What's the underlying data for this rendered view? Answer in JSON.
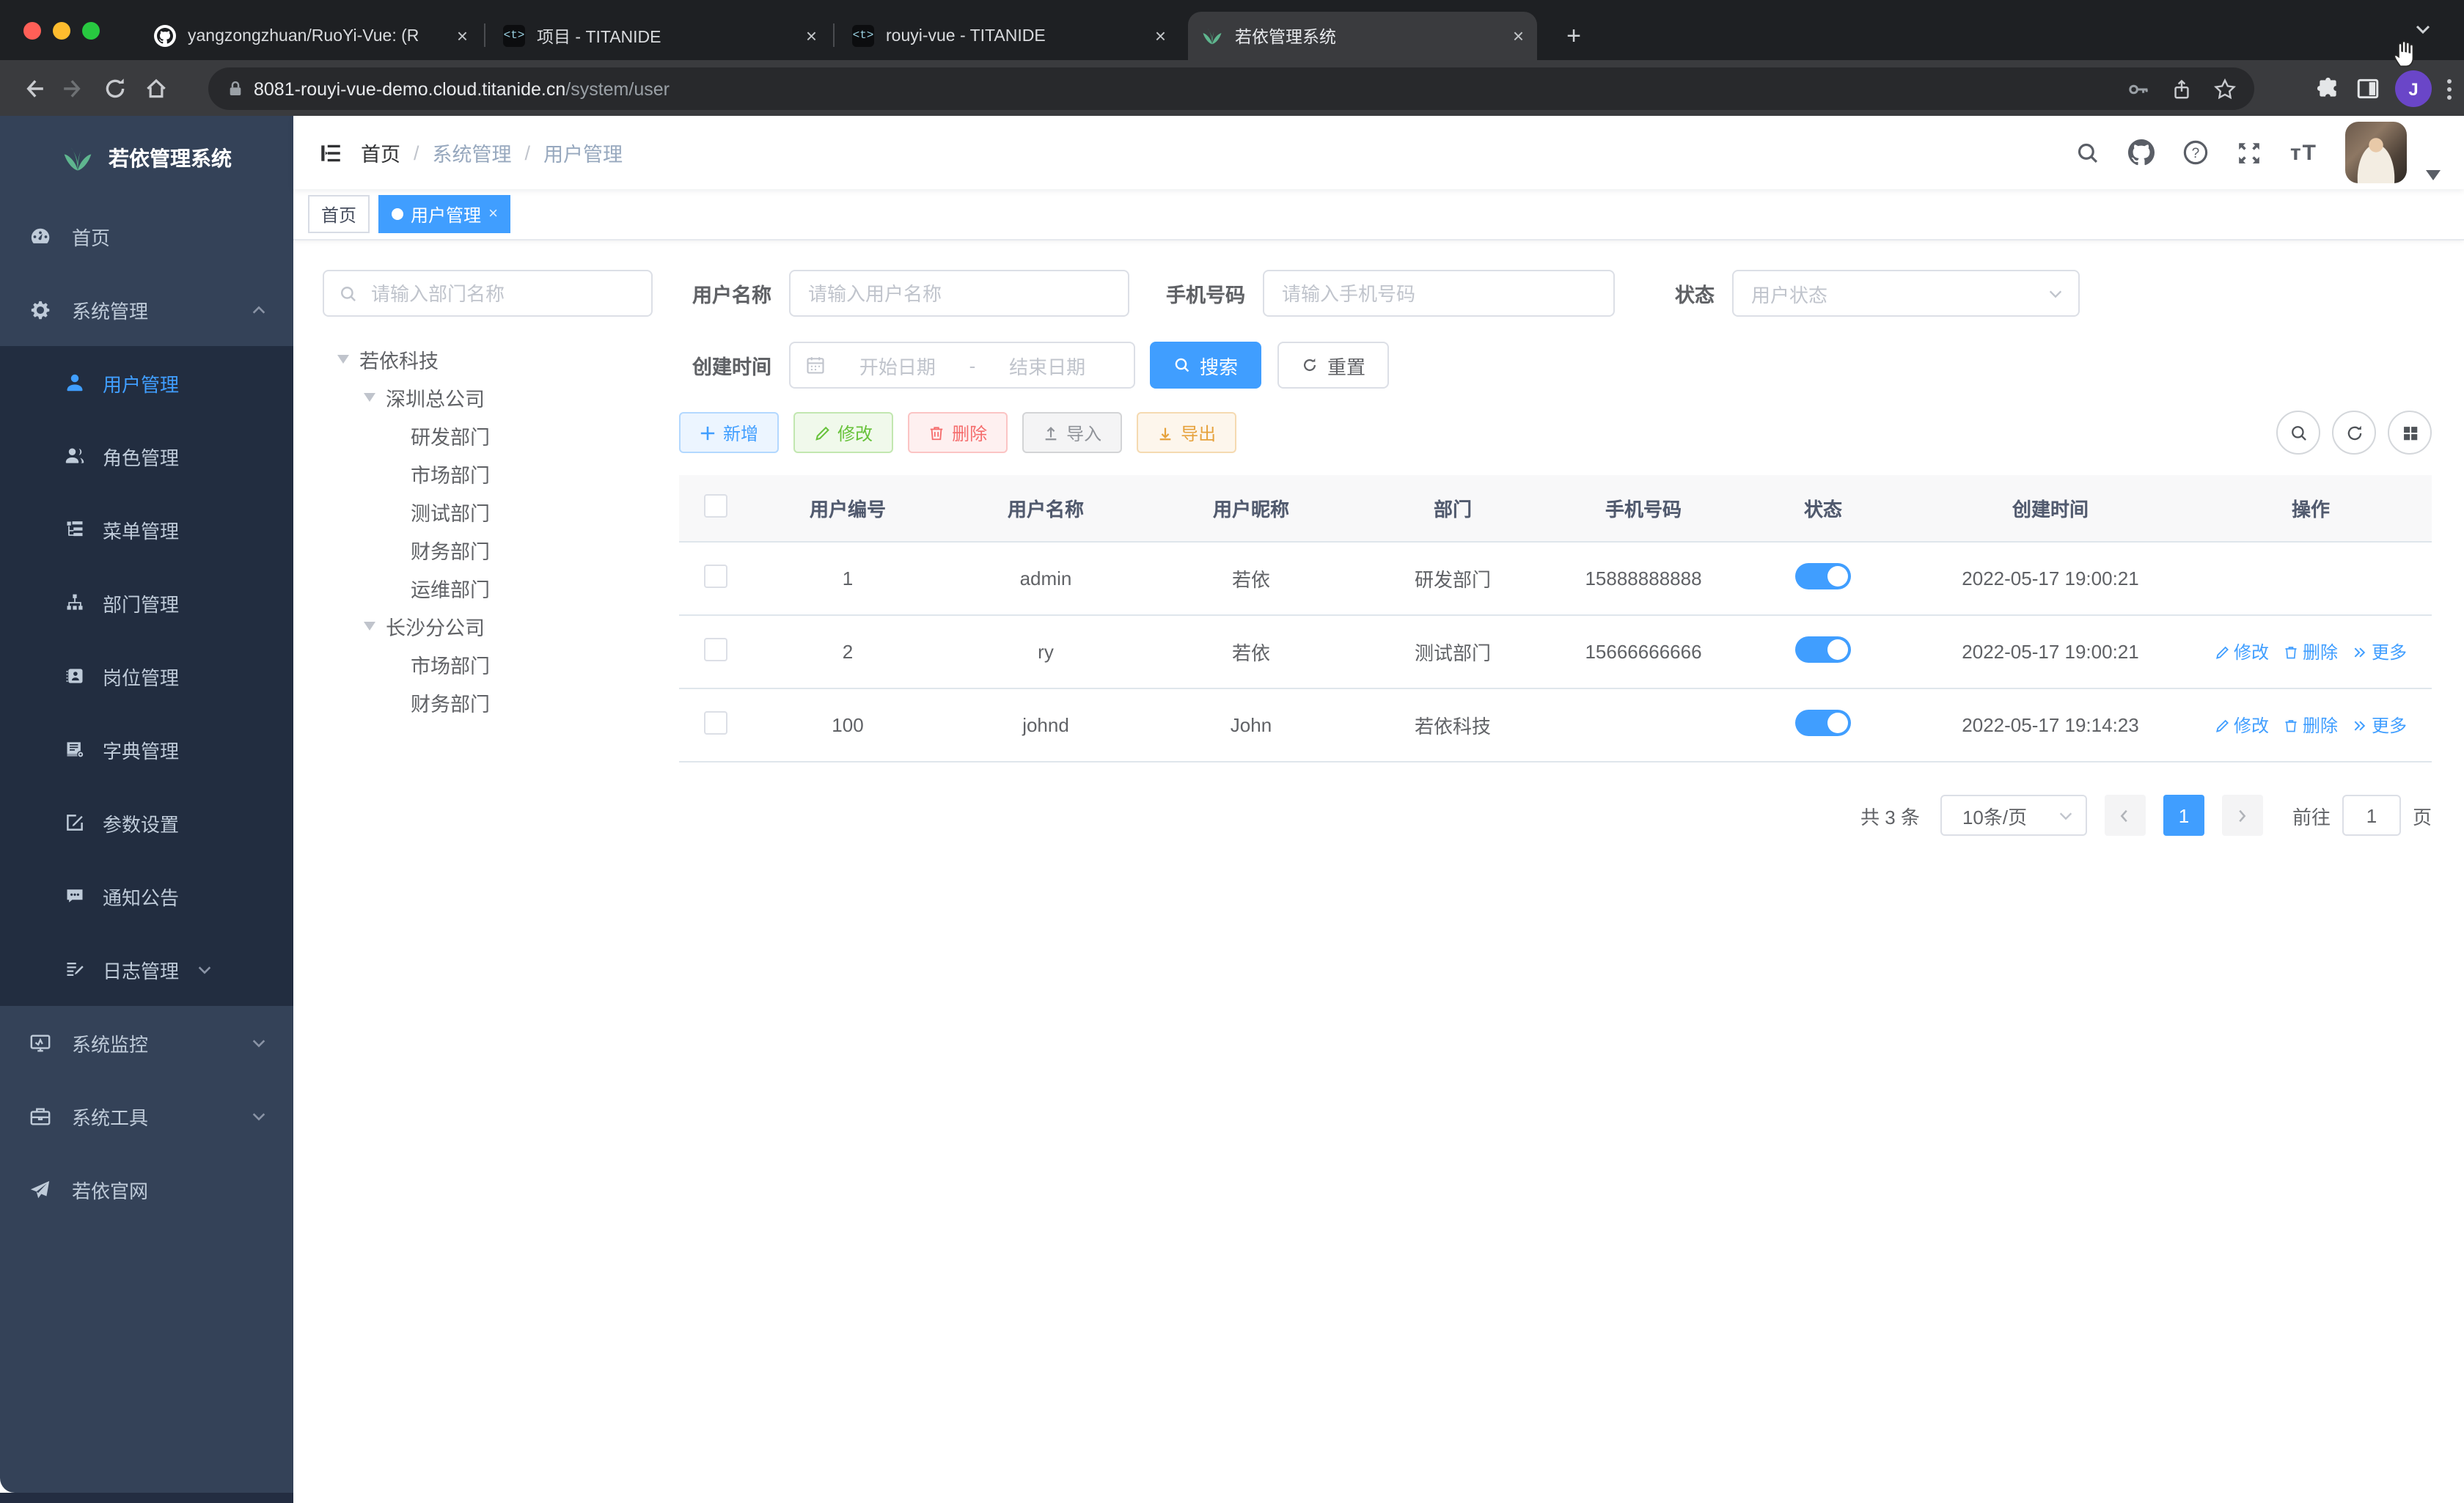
{
  "colors": {
    "accent": "#409eff",
    "sidebar_bg": "#344258",
    "submenu_bg": "#222d40",
    "sidebar_text": "#bfcbd9",
    "success": "#67c23a",
    "danger": "#f56c6c",
    "warning": "#e6a23c",
    "info": "#909399",
    "traffic_red": "#ff5f57",
    "traffic_yellow": "#febc2e",
    "traffic_green": "#28c840"
  },
  "browser": {
    "tabs": [
      {
        "title": "yangzongzhuan/RuoYi-Vue: (R",
        "icon": "github-favicon"
      },
      {
        "title": "项目 - TITANIDE",
        "icon": "titanide-favicon"
      },
      {
        "title": "rouyi-vue - TITANIDE",
        "icon": "titanide-favicon"
      },
      {
        "title": "若依管理系统",
        "icon": "ruoyi-favicon",
        "active": true
      }
    ],
    "tab_close_glyph": "×",
    "new_tab_glyph": "+",
    "favicon_titanide_glyph": "<t>",
    "url_host": "8081-rouyi-vue-demo.cloud.titanide.cn",
    "url_path": "/system/user",
    "profile_initial": "J"
  },
  "sidebar": {
    "logo_title": "若依管理系统",
    "top_items": [
      {
        "label": "首页"
      },
      {
        "label": "系统管理",
        "expanded": true
      }
    ],
    "submenu": [
      {
        "label": "用户管理",
        "active": true
      },
      {
        "label": "角色管理"
      },
      {
        "label": "菜单管理"
      },
      {
        "label": "部门管理"
      },
      {
        "label": "岗位管理"
      },
      {
        "label": "字典管理"
      },
      {
        "label": "参数设置"
      },
      {
        "label": "通知公告"
      },
      {
        "label": "日志管理",
        "collapsible": true
      }
    ],
    "bottom_items": [
      {
        "label": "系统监控",
        "collapsible": true
      },
      {
        "label": "系统工具",
        "collapsible": true
      },
      {
        "label": "若依官网"
      }
    ]
  },
  "navbar": {
    "breadcrumb": [
      "首页",
      "系统管理",
      "用户管理"
    ],
    "breadcrumb_separator": "/",
    "icons": [
      "search",
      "github",
      "help",
      "fullscreen",
      "font-size"
    ],
    "font_size_icon_text": "tT"
  },
  "tagsbar": {
    "close_glyph": "×",
    "tags": [
      {
        "label": "首页"
      },
      {
        "label": "用户管理",
        "active": true
      }
    ]
  },
  "dept_panel": {
    "search_placeholder": "请输入部门名称",
    "tree": [
      {
        "label": "若依科技",
        "level": 1,
        "expanded": true
      },
      {
        "label": "深圳总公司",
        "level": 2,
        "expanded": true
      },
      {
        "label": "研发部门",
        "level": 3
      },
      {
        "label": "市场部门",
        "level": 3
      },
      {
        "label": "测试部门",
        "level": 3
      },
      {
        "label": "财务部门",
        "level": 3
      },
      {
        "label": "运维部门",
        "level": 3
      },
      {
        "label": "长沙分公司",
        "level": 2,
        "expanded": true
      },
      {
        "label": "市场部门",
        "level": 3
      },
      {
        "label": "财务部门",
        "level": 3
      }
    ]
  },
  "filters": {
    "username_label": "用户名称",
    "username_placeholder": "请输入用户名称",
    "phone_label": "手机号码",
    "phone_placeholder": "请输入手机号码",
    "status_label": "状态",
    "status_placeholder": "用户状态",
    "created_label": "创建时间",
    "date_start_placeholder": "开始日期",
    "date_separator": "-",
    "date_end_placeholder": "结束日期",
    "search_button": "搜索",
    "reset_button": "重置"
  },
  "toolbar": {
    "add": "新增",
    "edit": "修改",
    "delete": "删除",
    "import": "导入",
    "export": "导出"
  },
  "table": {
    "columns": [
      "用户编号",
      "用户名称",
      "用户昵称",
      "部门",
      "手机号码",
      "状态",
      "创建时间",
      "操作"
    ],
    "action_labels": {
      "edit": "修改",
      "delete": "删除",
      "more": "更多"
    },
    "rows": [
      {
        "id": "1",
        "username": "admin",
        "nickname": "若依",
        "dept": "研发部门",
        "phone": "15888888888",
        "status_on": true,
        "created": "2022-05-17 19:00:21",
        "has_actions": false
      },
      {
        "id": "2",
        "username": "ry",
        "nickname": "若依",
        "dept": "测试部门",
        "phone": "15666666666",
        "status_on": true,
        "created": "2022-05-17 19:00:21",
        "has_actions": true
      },
      {
        "id": "100",
        "username": "johnd",
        "nickname": "John",
        "dept": "若依科技",
        "phone": "",
        "status_on": true,
        "created": "2022-05-17 19:14:23",
        "has_actions": true
      }
    ]
  },
  "pagination": {
    "total": "共 3 条",
    "page_size": "10条/页",
    "current_page": "1",
    "goto_label": "前往",
    "goto_value": "1",
    "goto_suffix": "页"
  }
}
